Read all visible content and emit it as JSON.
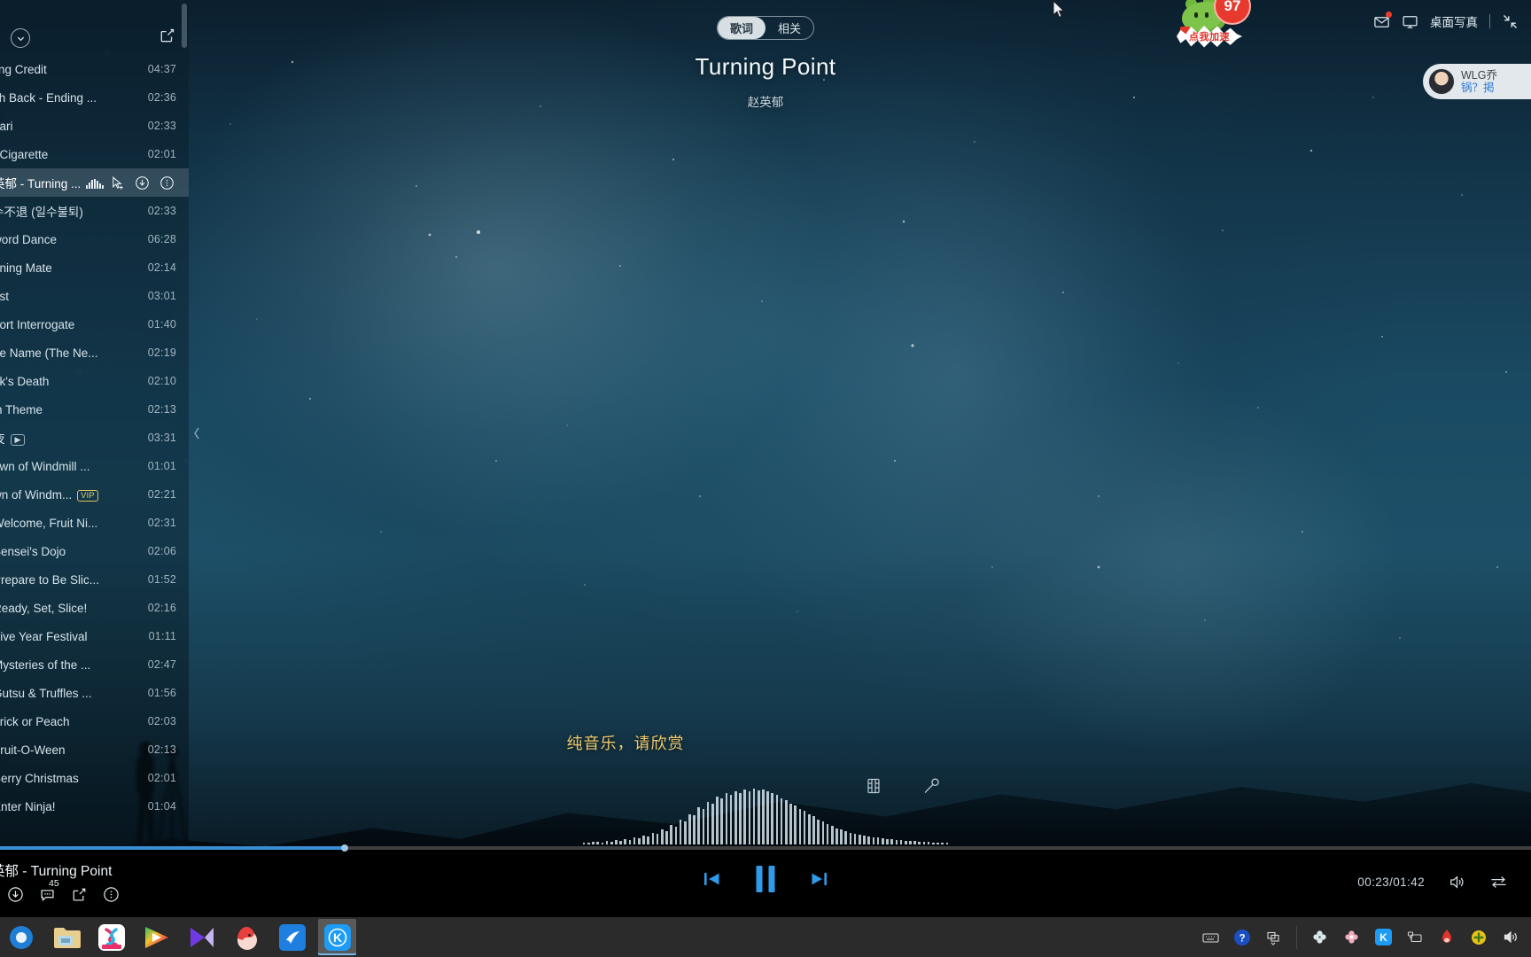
{
  "app": {
    "name": "kugou-music-fullscreen-player"
  },
  "header": {
    "tabs": [
      {
        "label": "歌词",
        "active": true,
        "name": "tab-lyrics"
      },
      {
        "label": "相关",
        "active": false,
        "name": "tab-related"
      }
    ],
    "song_title": "Turning Point",
    "song_artist": "赵英郁"
  },
  "tray": {
    "desktop_photo_label": "桌面写真",
    "mail_icon": "envelope-icon",
    "screen_icon": "monitor-icon",
    "fullscreen_icon": "exit-fullscreen-icon",
    "pet_badge": "97",
    "pet_cta": "点我加速"
  },
  "user_chip": {
    "line1": "WLG乔",
    "line2": "锅？掲"
  },
  "playlist": {
    "share_icon": "share-icon",
    "collapse_icon": "chevron-down-icon",
    "edge_collapse_icon": "chevron-left-icon",
    "tracks": [
      {
        "name": "ling Credit",
        "duration": "04:37"
      },
      {
        "name": "sh Back - Ending ...",
        "duration": "02:36"
      },
      {
        "name": "gari",
        "duration": "02:33"
      },
      {
        "name": "t Cigarette",
        "duration": "02:01"
      },
      {
        "name": "英郁 - Turning ...",
        "duration": "",
        "active": true
      },
      {
        "name": "수不退 (일수불퇴)",
        "duration": "02:33"
      },
      {
        "name": "word Dance",
        "duration": "06:28"
      },
      {
        "name": "nning Mate",
        "duration": "02:14"
      },
      {
        "name": "est",
        "duration": "03:01"
      },
      {
        "name": "port Interrogate",
        "duration": "01:40"
      },
      {
        "name": "de Name (The Ne...",
        "duration": "02:19"
      },
      {
        "name": "ok's Death",
        "duration": "02:10"
      },
      {
        "name": "in Theme",
        "duration": "02:13"
      },
      {
        "name": "夜",
        "duration": "03:31",
        "mv": true
      },
      {
        "name": "own of Windmill ...",
        "duration": "01:01"
      },
      {
        "name": "wn of Windm...",
        "duration": "02:21",
        "vip": "VIP"
      },
      {
        "name": "Welcome, Fruit Ni...",
        "duration": "02:31"
      },
      {
        "name": "Sensei's Dojo",
        "duration": "02:06"
      },
      {
        "name": "Prepare to Be Slic...",
        "duration": "01:52"
      },
      {
        "name": "Ready, Set, Slice!",
        "duration": "02:16"
      },
      {
        "name": "Five Year Festival",
        "duration": "01:11"
      },
      {
        "name": "Mysteries of the ...",
        "duration": "02:47"
      },
      {
        "name": "Gutsu & Truffles ...",
        "duration": "01:56"
      },
      {
        "name": "Trick or Peach",
        "duration": "02:03"
      },
      {
        "name": "Fruit-O-Ween",
        "duration": "02:13"
      },
      {
        "name": "Berry Christmas",
        "duration": "02:01"
      },
      {
        "name": "Enter Ninja!",
        "duration": "01:04"
      }
    ],
    "row_actions": [
      {
        "name": "playing-equalizer-icon"
      },
      {
        "name": "add-to-playlist-icon"
      },
      {
        "name": "download-icon"
      },
      {
        "name": "more-options-icon"
      }
    ]
  },
  "stage": {
    "lyric_line": "纯音乐，请欣赏",
    "mv_icon": "film-strip-icon",
    "karaoke_icon": "microphone-icon"
  },
  "player": {
    "now_playing": "英郁 - Turning Point",
    "download_icon": "download-icon",
    "comment_icon": "comment-icon",
    "comment_count": "45",
    "share_icon": "share-icon",
    "more_icon": "more-options-icon",
    "prev_icon": "previous-track-icon",
    "pause_icon": "pause-icon",
    "next_icon": "next-track-icon",
    "time": "00:23/01:42",
    "elapsed": "00:23",
    "total": "01:42",
    "progress_percent": 22.5,
    "volume_icon": "volume-icon",
    "play_mode_icon": "sequential-play-icon",
    "accent_color": "#2f9bea",
    "progress_color": "#3a8fd4"
  },
  "taskbar": {
    "apps": [
      {
        "name": "taskbar-browser",
        "glyph": "◉"
      },
      {
        "name": "taskbar-file-explorer",
        "glyph": "🗂"
      },
      {
        "name": "taskbar-youku",
        "glyph": "Y"
      },
      {
        "name": "taskbar-media-player",
        "glyph": "▶"
      },
      {
        "name": "taskbar-potplayer",
        "glyph": "▶"
      },
      {
        "name": "taskbar-firefox",
        "glyph": "●"
      },
      {
        "name": "taskbar-thunder",
        "glyph": "⬥"
      },
      {
        "name": "taskbar-kugou",
        "glyph": "K",
        "active": true
      }
    ],
    "tray": [
      {
        "name": "tray-keyboard-icon",
        "glyph": "⌨"
      },
      {
        "name": "tray-help-icon",
        "glyph": "?"
      },
      {
        "name": "tray-overflow-icon",
        "glyph": "▱"
      },
      {
        "name": "tray-clover-icon",
        "glyph": "✿"
      },
      {
        "name": "tray-flower-icon",
        "glyph": "✾"
      },
      {
        "name": "tray-kugou-icon",
        "glyph": "K"
      },
      {
        "name": "tray-network-icon",
        "glyph": "🖧"
      },
      {
        "name": "tray-thunder-icon",
        "glyph": "⬥"
      },
      {
        "name": "tray-update-icon",
        "glyph": "✚"
      },
      {
        "name": "tray-volume-icon",
        "glyph": "🔊"
      }
    ]
  },
  "waveform": {
    "bars": [
      2,
      2,
      3,
      3,
      2,
      4,
      3,
      5,
      4,
      6,
      5,
      8,
      7,
      10,
      9,
      13,
      12,
      17,
      15,
      22,
      20,
      28,
      26,
      34,
      33,
      42,
      40,
      48,
      46,
      54,
      52,
      58,
      56,
      60,
      58,
      62,
      60,
      63,
      61,
      62,
      60,
      58,
      56,
      52,
      50,
      46,
      44,
      40,
      38,
      34,
      32,
      28,
      26,
      23,
      21,
      18,
      17,
      15,
      13,
      12,
      11,
      10,
      9,
      8,
      8,
      7,
      6,
      6,
      5,
      5,
      4,
      4,
      4,
      3,
      3,
      3,
      2,
      2,
      2,
      2
    ]
  }
}
